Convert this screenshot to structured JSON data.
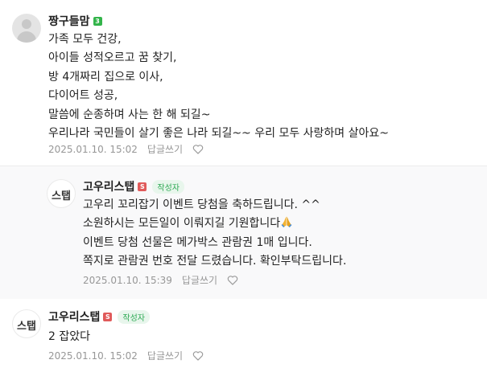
{
  "comments": [
    {
      "nickname": "짱구들맘",
      "level": "3",
      "is_author": false,
      "lines": [
        "가족 모두 건강,",
        "아이들 성적오르고 꿈 찾기,",
        "방 4개짜리 집으로 이사,",
        "다이어트 성공,",
        "말씀에 순종하며 사는 한 해 되길~",
        "우리나라 국민들이 살기 좋은 나라 되길~~ 우리 모두 사랑하며 살아요~"
      ],
      "date": "2025.01.10. 15:02",
      "reply_label": "답글쓰기"
    },
    {
      "nickname": "고우리스탭",
      "level": "S",
      "is_author": true,
      "author_badge": "작성자",
      "avatar_text": "스탭",
      "lines": [
        "고우리 꼬리잡기 이벤트 당첨을 축하드립니다. ^^",
        "소원하시는 모든일이 이뤄지길 기원합니다",
        "이벤트 당첨 선물은 메가박스 관람권 1매 입니다.",
        "쪽지로 관람권 번호 전달 드렸습니다. 확인부탁드립니다."
      ],
      "date": "2025.01.10. 15:39",
      "reply_label": "답글쓰기"
    },
    {
      "nickname": "고우리스탭",
      "level": "S",
      "is_author": true,
      "author_badge": "작성자",
      "avatar_text": "스탭",
      "lines": [
        "2 잡았다"
      ],
      "date": "2025.01.10. 15:02",
      "reply_label": "답글쓰기"
    }
  ],
  "colors": {
    "level_green": "#33b44a",
    "level_red": "#e05a5a",
    "author_badge": "#2faa55",
    "meta_gray": "#979797",
    "reply_background": "#f9f9fa"
  },
  "icons": {
    "heart": "heart-outline-icon",
    "praying_hands": "praying-hands-emoji-icon"
  }
}
